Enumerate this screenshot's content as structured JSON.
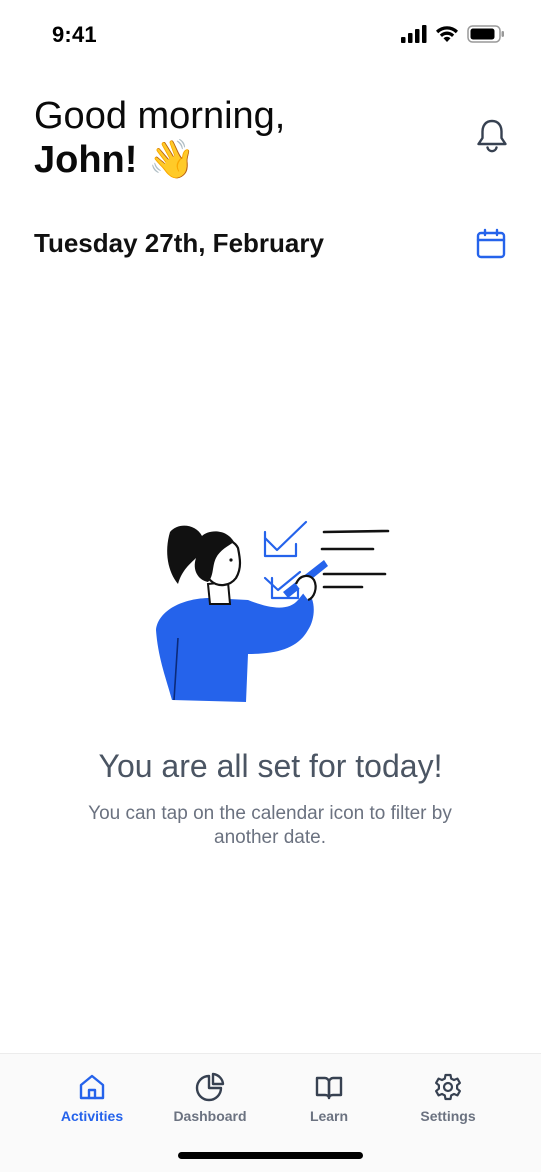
{
  "status_bar": {
    "time": "9:41",
    "icons": [
      "signal-icon",
      "wifi-icon",
      "battery-icon"
    ]
  },
  "header": {
    "greeting_line1": "Good morning,",
    "greeting_name": "John!",
    "greeting_emoji": "👋",
    "notification_icon": "bell-icon"
  },
  "date_bar": {
    "date_text": "Tuesday 27th, February",
    "calendar_icon": "calendar-icon"
  },
  "empty_state": {
    "title": "You are all set for today!",
    "subtitle": "You can tap on the calendar icon to filter by another date."
  },
  "bottom_nav": {
    "active": "Activities",
    "items": [
      {
        "label": "Activities",
        "icon": "home-icon"
      },
      {
        "label": "Dashboard",
        "icon": "pie-chart-icon"
      },
      {
        "label": "Learn",
        "icon": "book-icon"
      },
      {
        "label": "Settings",
        "icon": "gear-icon"
      }
    ]
  },
  "colors": {
    "accent": "#2563eb",
    "text_primary": "#111111",
    "text_muted": "#6b7280"
  }
}
